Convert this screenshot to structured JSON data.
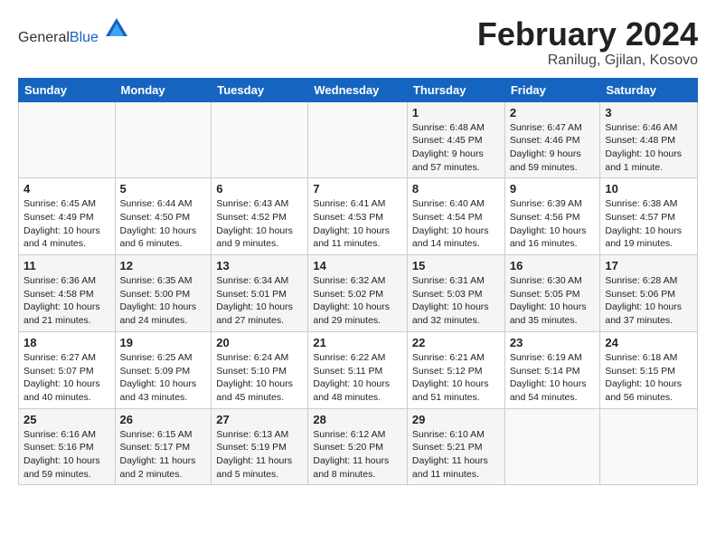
{
  "header": {
    "logo_general": "General",
    "logo_blue": "Blue",
    "title": "February 2024",
    "location": "Ranilug, Gjilan, Kosovo"
  },
  "days_of_week": [
    "Sunday",
    "Monday",
    "Tuesday",
    "Wednesday",
    "Thursday",
    "Friday",
    "Saturday"
  ],
  "weeks": [
    [
      {
        "day": "",
        "info": ""
      },
      {
        "day": "",
        "info": ""
      },
      {
        "day": "",
        "info": ""
      },
      {
        "day": "",
        "info": ""
      },
      {
        "day": "1",
        "info": "Sunrise: 6:48 AM\nSunset: 4:45 PM\nDaylight: 9 hours\nand 57 minutes."
      },
      {
        "day": "2",
        "info": "Sunrise: 6:47 AM\nSunset: 4:46 PM\nDaylight: 9 hours\nand 59 minutes."
      },
      {
        "day": "3",
        "info": "Sunrise: 6:46 AM\nSunset: 4:48 PM\nDaylight: 10 hours\nand 1 minute."
      }
    ],
    [
      {
        "day": "4",
        "info": "Sunrise: 6:45 AM\nSunset: 4:49 PM\nDaylight: 10 hours\nand 4 minutes."
      },
      {
        "day": "5",
        "info": "Sunrise: 6:44 AM\nSunset: 4:50 PM\nDaylight: 10 hours\nand 6 minutes."
      },
      {
        "day": "6",
        "info": "Sunrise: 6:43 AM\nSunset: 4:52 PM\nDaylight: 10 hours\nand 9 minutes."
      },
      {
        "day": "7",
        "info": "Sunrise: 6:41 AM\nSunset: 4:53 PM\nDaylight: 10 hours\nand 11 minutes."
      },
      {
        "day": "8",
        "info": "Sunrise: 6:40 AM\nSunset: 4:54 PM\nDaylight: 10 hours\nand 14 minutes."
      },
      {
        "day": "9",
        "info": "Sunrise: 6:39 AM\nSunset: 4:56 PM\nDaylight: 10 hours\nand 16 minutes."
      },
      {
        "day": "10",
        "info": "Sunrise: 6:38 AM\nSunset: 4:57 PM\nDaylight: 10 hours\nand 19 minutes."
      }
    ],
    [
      {
        "day": "11",
        "info": "Sunrise: 6:36 AM\nSunset: 4:58 PM\nDaylight: 10 hours\nand 21 minutes."
      },
      {
        "day": "12",
        "info": "Sunrise: 6:35 AM\nSunset: 5:00 PM\nDaylight: 10 hours\nand 24 minutes."
      },
      {
        "day": "13",
        "info": "Sunrise: 6:34 AM\nSunset: 5:01 PM\nDaylight: 10 hours\nand 27 minutes."
      },
      {
        "day": "14",
        "info": "Sunrise: 6:32 AM\nSunset: 5:02 PM\nDaylight: 10 hours\nand 29 minutes."
      },
      {
        "day": "15",
        "info": "Sunrise: 6:31 AM\nSunset: 5:03 PM\nDaylight: 10 hours\nand 32 minutes."
      },
      {
        "day": "16",
        "info": "Sunrise: 6:30 AM\nSunset: 5:05 PM\nDaylight: 10 hours\nand 35 minutes."
      },
      {
        "day": "17",
        "info": "Sunrise: 6:28 AM\nSunset: 5:06 PM\nDaylight: 10 hours\nand 37 minutes."
      }
    ],
    [
      {
        "day": "18",
        "info": "Sunrise: 6:27 AM\nSunset: 5:07 PM\nDaylight: 10 hours\nand 40 minutes."
      },
      {
        "day": "19",
        "info": "Sunrise: 6:25 AM\nSunset: 5:09 PM\nDaylight: 10 hours\nand 43 minutes."
      },
      {
        "day": "20",
        "info": "Sunrise: 6:24 AM\nSunset: 5:10 PM\nDaylight: 10 hours\nand 45 minutes."
      },
      {
        "day": "21",
        "info": "Sunrise: 6:22 AM\nSunset: 5:11 PM\nDaylight: 10 hours\nand 48 minutes."
      },
      {
        "day": "22",
        "info": "Sunrise: 6:21 AM\nSunset: 5:12 PM\nDaylight: 10 hours\nand 51 minutes."
      },
      {
        "day": "23",
        "info": "Sunrise: 6:19 AM\nSunset: 5:14 PM\nDaylight: 10 hours\nand 54 minutes."
      },
      {
        "day": "24",
        "info": "Sunrise: 6:18 AM\nSunset: 5:15 PM\nDaylight: 10 hours\nand 56 minutes."
      }
    ],
    [
      {
        "day": "25",
        "info": "Sunrise: 6:16 AM\nSunset: 5:16 PM\nDaylight: 10 hours\nand 59 minutes."
      },
      {
        "day": "26",
        "info": "Sunrise: 6:15 AM\nSunset: 5:17 PM\nDaylight: 11 hours\nand 2 minutes."
      },
      {
        "day": "27",
        "info": "Sunrise: 6:13 AM\nSunset: 5:19 PM\nDaylight: 11 hours\nand 5 minutes."
      },
      {
        "day": "28",
        "info": "Sunrise: 6:12 AM\nSunset: 5:20 PM\nDaylight: 11 hours\nand 8 minutes."
      },
      {
        "day": "29",
        "info": "Sunrise: 6:10 AM\nSunset: 5:21 PM\nDaylight: 11 hours\nand 11 minutes."
      },
      {
        "day": "",
        "info": ""
      },
      {
        "day": "",
        "info": ""
      }
    ]
  ]
}
